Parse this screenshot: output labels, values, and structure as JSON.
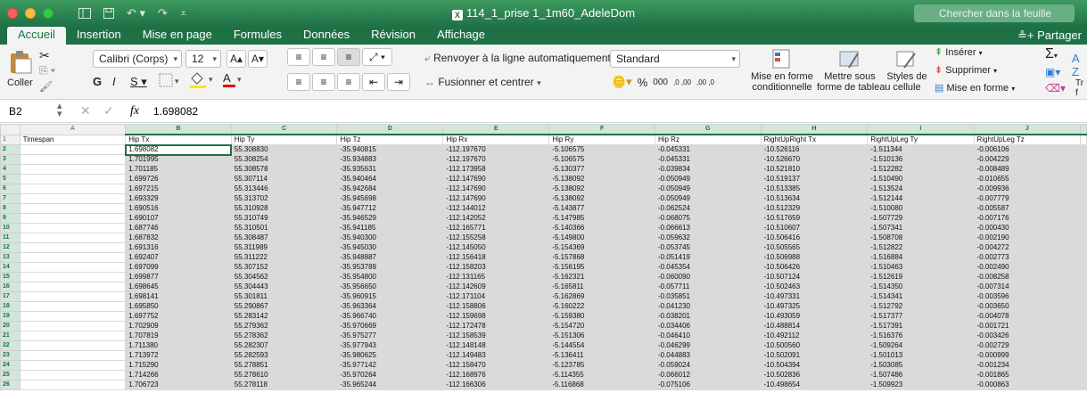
{
  "window": {
    "title": "114_1_prise 1_1m60_AdeleDom",
    "title_badge": "X",
    "search_placeholder": "Chercher dans la feuille"
  },
  "tabs": [
    "Accueil",
    "Insertion",
    "Mise en page",
    "Formules",
    "Données",
    "Révision",
    "Affichage"
  ],
  "share_label": "Partager",
  "ribbon": {
    "paste_label": "Coller",
    "font_name": "Calibri (Corps)",
    "font_size": "12",
    "grow_font": "A",
    "shrink_font": "A",
    "bold": "G",
    "italic": "I",
    "underline": "S",
    "font_color_letter": "A",
    "wrap_text": "Renvoyer à la ligne automatiquement",
    "merge_center": "Fusionner et centrer",
    "number_format": "Standard",
    "percent": "%",
    "thousands": "000",
    "dec_increase": ",0 ,00",
    "dec_decrease": ",00 ,0",
    "conditional_format": "Mise en forme\nconditionnelle",
    "format_table": "Mettre sous\nforme de tableau",
    "cell_styles": "Styles de\ncellule",
    "insert": "Insérer",
    "delete": "Supprimer",
    "format": "Mise en forme",
    "sigma": "Σ",
    "trier": "Tr",
    "trier2": "f"
  },
  "formula_bar": {
    "name_box": "B2",
    "fx": "fx",
    "value": "1.698082"
  },
  "colors": {
    "accent": "#1e7145",
    "selection": "#dadada"
  },
  "columns": [
    "A",
    "B",
    "C",
    "D",
    "E",
    "F",
    "G",
    "H",
    "I",
    "J"
  ],
  "header_row": [
    "Timespan",
    "Hip Tx",
    "Hip Ty",
    "Hip Tz",
    "Hip Rx",
    "Hip Ry",
    "Hip Rz",
    "RightUpRight Tx",
    "RightUpLeg Ty",
    "RightUpLeg Tz"
  ],
  "rows": [
    [
      "",
      "1.698082",
      "55.308830",
      "-35.940815",
      "-112.197670",
      "-5.106575",
      "-0.045331",
      "-10.526116",
      "-1.511344",
      "-0.006106"
    ],
    [
      "",
      "1.701995",
      "55.308254",
      "-35.934883",
      "-112.197670",
      "-5.106575",
      "-0.045331",
      "-10.526670",
      "-1.510136",
      "-0.004229"
    ],
    [
      "",
      "1.701185",
      "55.308578",
      "-35.935631",
      "-112.173958",
      "-5.130377",
      "-0.039834",
      "-10.521810",
      "-1.512282",
      "-0.008489"
    ],
    [
      "",
      "1.699726",
      "55.307114",
      "-35.940464",
      "-112.147690",
      "-5.138092",
      "-0.050949",
      "-10.519137",
      "-1.510490",
      "-0.010655"
    ],
    [
      "",
      "1.697215",
      "55.313446",
      "-35.942684",
      "-112.147690",
      "-5.138092",
      "-0.050949",
      "-10.513385",
      "-1.513524",
      "-0.009936"
    ],
    [
      "",
      "1.693329",
      "55.313702",
      "-35.945698",
      "-112.147690",
      "-5.138092",
      "-0.050949",
      "-10.513634",
      "-1.512144",
      "-0.007779"
    ],
    [
      "",
      "1.690516",
      "55.310928",
      "-35.947712",
      "-112.144012",
      "-5.143877",
      "-0.062524",
      "-10.512329",
      "-1.510080",
      "-0.005587"
    ],
    [
      "",
      "1.690107",
      "55.310749",
      "-35.946529",
      "-112.142052",
      "-5.147985",
      "-0.068075",
      "-10.517659",
      "-1.507729",
      "-0.007176"
    ],
    [
      "",
      "1.687746",
      "55.310501",
      "-35.941185",
      "-112.165771",
      "-5.140366",
      "-0.066613",
      "-10.510607",
      "-1.507341",
      "-0.000430"
    ],
    [
      "",
      "1.687832",
      "55.308487",
      "-35.940300",
      "-112.155258",
      "-5.149800",
      "-0.059632",
      "-10.506416",
      "-1.508708",
      "-0.002190"
    ],
    [
      "",
      "1.691316",
      "55.311989",
      "-35.945030",
      "-112.145050",
      "-5.154369",
      "-0.053745",
      "-10.505565",
      "-1.512822",
      "-0.004272"
    ],
    [
      "",
      "1.692407",
      "55.311222",
      "-35.948887",
      "-112.156418",
      "-5.157868",
      "-0.051419",
      "-10.506988",
      "-1.516884",
      "-0.002773"
    ],
    [
      "",
      "1.697099",
      "55.307152",
      "-35.953789",
      "-112.158203",
      "-5.156195",
      "-0.045354",
      "-10.506426",
      "-1.510463",
      "-0.002490"
    ],
    [
      "",
      "1.699877",
      "55.304562",
      "-35.954800",
      "-112.131165",
      "-5.162321",
      "-0.060090",
      "-10.507124",
      "-1.512619",
      "-0.008258"
    ],
    [
      "",
      "1.698645",
      "55.304443",
      "-35.956650",
      "-112.142609",
      "-5.165811",
      "-0.057711",
      "-10.502463",
      "-1.514350",
      "-0.007314"
    ],
    [
      "",
      "1.698141",
      "55.301811",
      "-35.960915",
      "-112.171104",
      "-5.162869",
      "-0.035851",
      "-10.497331",
      "-1.514341",
      "-0.003596"
    ],
    [
      "",
      "1.695850",
      "55.290867",
      "-35.963364",
      "-112.158806",
      "-5.160222",
      "-0.041230",
      "-10.497325",
      "-1.512792",
      "-0.003650"
    ],
    [
      "",
      "1.697752",
      "55.283142",
      "-35.966740",
      "-112.159698",
      "-5.159380",
      "-0.038201",
      "-10.493059",
      "-1.517377",
      "-0.004078"
    ],
    [
      "",
      "1.702909",
      "55.279362",
      "-35.970669",
      "-112.172478",
      "-5.154720",
      "-0.034406",
      "-10.488814",
      "-1.517391",
      "-0.001721"
    ],
    [
      "",
      "1.707819",
      "55.278362",
      "-35.975277",
      "-112.158539",
      "-5.151306",
      "-0.046410",
      "-10.492112",
      "-1.516376",
      "-0.003426"
    ],
    [
      "",
      "1.711380",
      "55.282307",
      "-35.977943",
      "-112.148148",
      "-5.144554",
      "-0.046299",
      "-10.500560",
      "-1.509264",
      "-0.002729"
    ],
    [
      "",
      "1.713972",
      "55.282593",
      "-35.980625",
      "-112.149483",
      "-5.136411",
      "-0.044883",
      "-10.502091",
      "-1.501013",
      "-0.000999"
    ],
    [
      "",
      "1.715290",
      "55.278851",
      "-35.977142",
      "-112.158470",
      "-5.123785",
      "-0.059024",
      "-10.504394",
      "-1.503085",
      "-0.001234"
    ],
    [
      "",
      "1.714266",
      "55.278610",
      "-35.970264",
      "-112.168976",
      "-5.114355",
      "-0.066012",
      "-10.502836",
      "-1.507486",
      "-0.001865"
    ],
    [
      "",
      "1.706723",
      "55.278118",
      "-35.965244",
      "-112.166306",
      "-5.116868",
      "-0.075106",
      "-10.498654",
      "-1.509923",
      "-0.000863"
    ]
  ]
}
